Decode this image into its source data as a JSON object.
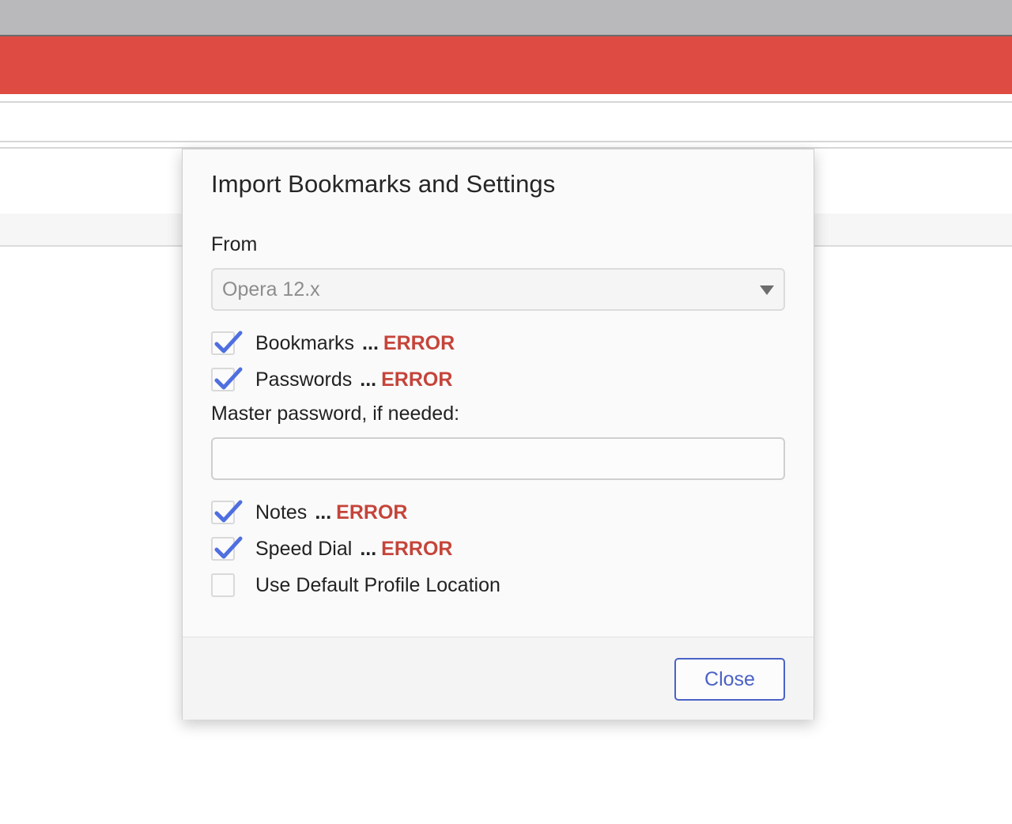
{
  "dialog": {
    "title": "Import Bookmarks and Settings",
    "from_label": "From",
    "source_select": {
      "value": "Opera 12.x"
    },
    "items": [
      {
        "label": "Bookmarks",
        "checked": true,
        "dots": "...",
        "status": "ERROR"
      },
      {
        "label": "Passwords",
        "checked": true,
        "dots": "...",
        "status": "ERROR"
      },
      {
        "label": "Notes",
        "checked": true,
        "dots": "...",
        "status": "ERROR"
      },
      {
        "label": "Speed Dial",
        "checked": true,
        "dots": "...",
        "status": "ERROR"
      },
      {
        "label": "Use Default Profile Location",
        "checked": false
      }
    ],
    "master_password": {
      "label": "Master password, if needed:",
      "value": ""
    },
    "close_label": "Close"
  },
  "colors": {
    "accent": "#4a62c6",
    "checkmark": "#4f6fe0",
    "error": "#c5443a",
    "toolbar_red": "#de4b42"
  }
}
